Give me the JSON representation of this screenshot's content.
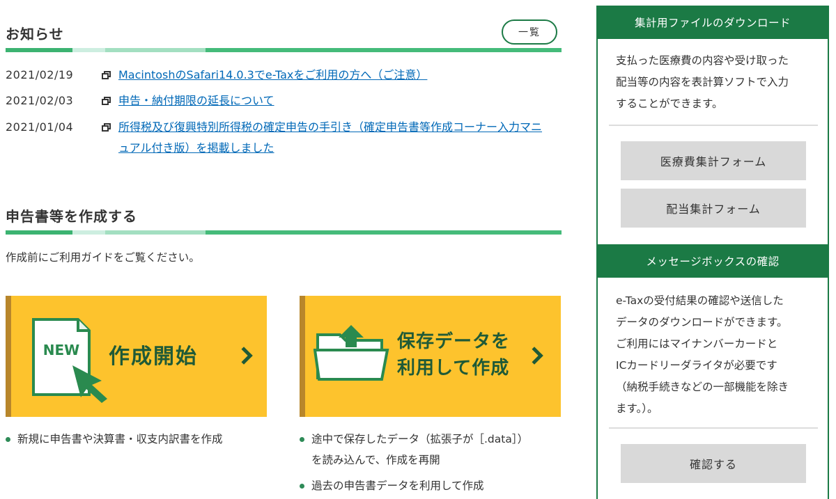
{
  "news": {
    "title": "お知らせ",
    "list_button": "一覧",
    "items": [
      {
        "date": "2021/02/19",
        "text": "MacintoshのSafari14.0.3でe-Taxをご利用の方へ（ご注意）"
      },
      {
        "date": "2021/02/03",
        "text": "申告・納付期限の延長について"
      },
      {
        "date": "2021/01/04",
        "text": "所得税及び復興特別所得税の確定申告の手引き（確定申告書等作成コーナー入力マニュアル付き版）を掲載しました"
      }
    ]
  },
  "create": {
    "title": "申告書等を作成する",
    "intro": "作成前にご利用ガイドをご覧ください。",
    "tile_new": {
      "badge": "NEW",
      "label": "作成開始"
    },
    "tile_saved": {
      "label_line1": "保存データを",
      "label_line2": "利用して作成"
    },
    "new_bullets": [
      "新規に申告書や決算書・収支内訳書を作成"
    ],
    "saved_bullets": [
      "途中で保存したデータ（拡張子が［.data］）",
      "を読み込んで、作成を再開",
      "過去の申告書データを利用して作成"
    ]
  },
  "sidebar": {
    "download": {
      "title": "集計用ファイルのダウンロード",
      "text_lines": [
        "支払った医療費の内容や受け取った",
        "配当等の内容を表計算ソフトで入力",
        "することができます。"
      ],
      "buttons": [
        "医療費集計フォーム",
        "配当集計フォーム"
      ]
    },
    "messagebox": {
      "title": "メッセージボックスの確認",
      "text_lines": [
        "e-Taxの受付結果の確認や送信した",
        "データのダウンロードができます。",
        "ご利用にはマイナンバーカードと",
        "ICカードリーダライタが必要です",
        "（納税手続きなどの一部機能を除き",
        "ます。）。"
      ],
      "button": "確認する"
    }
  },
  "colors": {
    "accent_green": "#1b7a45",
    "tile_yellow": "#fdc32d",
    "link_blue": "#0068b7"
  }
}
